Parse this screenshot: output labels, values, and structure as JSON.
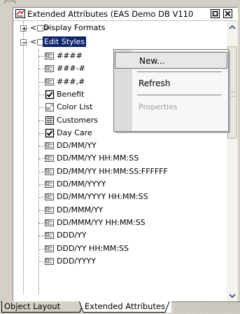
{
  "window": {
    "title": "Extended Attributes (EAS Demo DB V110"
  },
  "tree": {
    "groups": [
      {
        "label": "Display Formats",
        "expanded": false,
        "tag": "<□>"
      },
      {
        "label": "Edit Styles",
        "expanded": true,
        "tag": "<□>"
      }
    ],
    "items": [
      {
        "label": "####",
        "icon": "edit-mask-icon"
      },
      {
        "label": "###-#",
        "icon": "edit-mask-icon"
      },
      {
        "label": "###,#",
        "icon": "edit-mask-icon"
      },
      {
        "label": "Benefit",
        "icon": "checkbox-icon"
      },
      {
        "label": "Color List",
        "icon": "dropdown-list-icon"
      },
      {
        "label": "Customers",
        "icon": "list-icon"
      },
      {
        "label": "Day Care",
        "icon": "checkbox-icon"
      },
      {
        "label": "DD/MM/YY",
        "icon": "edit-mask-icon"
      },
      {
        "label": "DD/MM/YY HH:MM:SS",
        "icon": "edit-mask-icon"
      },
      {
        "label": "DD/MM/YY HH:MM:SS:FFFFFF",
        "icon": "edit-mask-icon"
      },
      {
        "label": "DD/MM/YYYY",
        "icon": "edit-mask-icon"
      },
      {
        "label": "DD/MM/YYYY HH:MM:SS",
        "icon": "edit-mask-icon"
      },
      {
        "label": "DD/MMM/YY",
        "icon": "edit-mask-icon"
      },
      {
        "label": "DD/MMM/YY HH:MM:SS",
        "icon": "edit-mask-icon"
      },
      {
        "label": "DDD/YY",
        "icon": "edit-mask-icon"
      },
      {
        "label": "DDD/YY HH:MM:SS",
        "icon": "edit-mask-icon"
      },
      {
        "label": "DDD/YYYY",
        "icon": "edit-mask-icon"
      }
    ]
  },
  "context_menu": {
    "items": [
      {
        "label": "New...",
        "state": "hover"
      },
      {
        "label": "Refresh",
        "state": "normal"
      },
      {
        "label": "Properties",
        "state": "disabled"
      }
    ]
  },
  "tabs": [
    {
      "label": "Object Layout",
      "active": false
    },
    {
      "label": "Extended Attributes",
      "active": true
    }
  ],
  "colors": {
    "selection": "#0a246a",
    "menu_bg": "#f7f7f7",
    "menu_hover": "#e7e7e7",
    "chrome": "#d4d0c8"
  }
}
